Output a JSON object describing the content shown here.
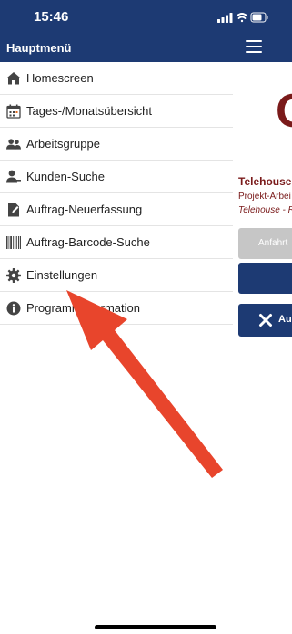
{
  "status": {
    "time": "15:46"
  },
  "header": {
    "title": "Hauptmenü"
  },
  "menu": {
    "items": [
      {
        "label": "Homescreen",
        "icon": "home-icon"
      },
      {
        "label": "Tages-/Monatsübersicht",
        "icon": "calendar-icon"
      },
      {
        "label": "Arbeitsgruppe",
        "icon": "group-icon"
      },
      {
        "label": "Kunden-Suche",
        "icon": "user-search-icon"
      },
      {
        "label": "Auftrag-Neuerfassung",
        "icon": "edit-document-icon"
      },
      {
        "label": "Auftrag-Barcode-Suche",
        "icon": "barcode-icon"
      },
      {
        "label": "Einstellungen",
        "icon": "gear-icon"
      },
      {
        "label": "Programminformation",
        "icon": "info-icon"
      }
    ]
  },
  "background": {
    "big_letter": "O",
    "title": "Telehouse",
    "subtitle": "Projekt-Arbei",
    "subtitle_italic": "Telehouse - R",
    "grey_button": "Anfahrt",
    "blue_button2": "Au"
  },
  "colors": {
    "brand": "#1d3a73",
    "accent": "#7a1a1a",
    "arrow": "#e8452c"
  }
}
